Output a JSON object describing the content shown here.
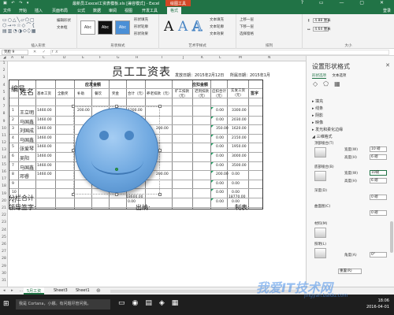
{
  "titlebar": {
    "title": "最新员工excel工资表模板.xls [兼容模式] - Excel",
    "context_tools": "绘图工具",
    "window_buttons": "? ▭ — ▢ ✕"
  },
  "tabs": [
    "文件",
    "开始",
    "插入",
    "页面布局",
    "公式",
    "数据",
    "审阅",
    "视图",
    "开发工具",
    "格式"
  ],
  "active_tab": "格式",
  "sign_in": "登录",
  "ribbon": {
    "insert_shapes": {
      "name": "插入形状",
      "edit_shape": "编辑形状",
      "text_box": "文本框"
    },
    "shape_styles": {
      "name": "形状样式",
      "swatches": [
        "Abc",
        "Abc",
        "Abc"
      ],
      "fill": "形状填充",
      "outline": "形状轮廓",
      "effects": "形状效果"
    },
    "wordart": {
      "name": "艺术字样式",
      "letters": [
        "A",
        "A",
        "A"
      ],
      "text_fill": "文本填充",
      "text_outline": "文本轮廓",
      "text_effects": "文本效果"
    },
    "arrange": {
      "name": "排列",
      "items": [
        "上移一层",
        "下移一层",
        "选择窗格"
      ]
    },
    "size": {
      "name": "大小",
      "height": "4.88 厘米",
      "width": "4.64 厘米"
    }
  },
  "formula_bar": {
    "name_box": "笑脸 9",
    "fx": "✕ ✓ fx",
    "value": ""
  },
  "columns": [
    "A",
    "B",
    "C",
    "D",
    "E",
    "F",
    "G",
    "H",
    "I",
    "J",
    "K",
    "L",
    "M",
    "N"
  ],
  "rows": [
    "1",
    "2",
    "3",
    "4",
    "5",
    "6",
    "7",
    "8",
    "9",
    "10",
    "11",
    "12",
    "13",
    "14",
    "15",
    "16",
    "17",
    "18",
    "19",
    "20",
    "21",
    "22",
    "23",
    "24",
    "25",
    "26",
    "27",
    "28",
    "29",
    "30",
    "31"
  ],
  "sheet": {
    "title": "员工工资表",
    "issue_date": "发放日期：2015年2月12日",
    "statement_date": "所属日期：2015年1月",
    "headers": {
      "seq": "编号",
      "name": "姓名",
      "payable": "应发金额",
      "deduct": "应扣金额",
      "net_pay": "实发工资（元）",
      "sign": "签字",
      "base": "基本工资",
      "position": "全勤奖",
      "allowance": "补助",
      "subsidy": "餐饮",
      "bonus": "奖金",
      "total": "合计（元）",
      "social": "养老扣款（元）",
      "absence": "旷工扣款（元）",
      "late": "迟到扣款（元）",
      "deduct_total": "应扣合计（元）"
    },
    "data_rows": [
      {
        "seq": "1",
        "name": "王立明",
        "base": "1460.00",
        "allow": "200.00",
        "total": "1200.00",
        "social": "",
        "deduct": "0.00",
        "net": "3300.00"
      },
      {
        "seq": "2",
        "name": "马国鑫",
        "base": "1460.00",
        "allow": "",
        "total": "",
        "social": "",
        "deduct": "0.00",
        "net": "2030.00"
      },
      {
        "seq": "3",
        "name": "刘国成",
        "base": "1460.00",
        "allow": "",
        "total": "",
        "social": "200.00",
        "deduct": "350.00",
        "net": "1620.00"
      },
      {
        "seq": "4",
        "name": "马国鑫",
        "base": "1460.00",
        "allow": "",
        "total": "",
        "social": "",
        "deduct": "0.00",
        "net": "2150.00"
      },
      {
        "seq": "5",
        "name": "张爱琴",
        "base": "1460.00",
        "allow": "",
        "total": "",
        "social": "",
        "deduct": "0.00",
        "net": "1950.00"
      },
      {
        "seq": "6",
        "name": "吴阳",
        "base": "1460.00",
        "allow": "",
        "total": "",
        "social": "",
        "deduct": "0.00",
        "net": "3000.00"
      },
      {
        "seq": "7",
        "name": "马国鑫",
        "base": "1460.00",
        "allow": "",
        "total": "",
        "social": "",
        "deduct": "0.00",
        "net": "3500.00"
      },
      {
        "seq": "8",
        "name": "邓睿",
        "base": "1460.00",
        "allow": "",
        "total": "",
        "social": "200.00",
        "deduct": "200.00",
        "net": "0.00"
      },
      {
        "seq": "9",
        "name": "",
        "base": "",
        "allow": "",
        "total": "",
        "social": "",
        "deduct": "0.00",
        "net": "0.00"
      },
      {
        "seq": "10",
        "name": "",
        "base": "",
        "allow": "",
        "total": "",
        "social": "",
        "deduct": "0.00",
        "net": "0.00"
      },
      {
        "seq": "11",
        "name": "",
        "base": "",
        "allow": "",
        "total": "0.00",
        "social": "",
        "deduct": "0.00",
        "net": "0.00"
      }
    ],
    "subtotal_label": "分栏合计",
    "subtotal_total": "18600.00",
    "subtotal_net": "18770.00",
    "footer": {
      "leader": "领导签字:",
      "cashier": "出纳:",
      "maker": "制表:"
    }
  },
  "format_pane": {
    "title": "设置形状格式",
    "close": "✕",
    "tabs": [
      "形状选项",
      "文本选项"
    ],
    "sections": [
      "填充",
      "线条",
      "阴影",
      "映像",
      "发光和柔化边缘",
      "三维格式"
    ],
    "top_bevel": "顶部棱台(T)",
    "bottom_bevel": "底部棱台(B)",
    "width_label": "宽度(W)",
    "height_label": "高度(H)",
    "top_width": "10 磅",
    "top_height": "6 磅",
    "bottom_width": "10磅",
    "bottom_height": "6 磅",
    "depth": "深度(D)",
    "depth_size": "0 磅",
    "contour": "曲面图(C)",
    "contour_size": "0 磅",
    "material": "材料(M)",
    "lighting": "照明(L)",
    "angle_label": "角度(A)",
    "angle": "0°",
    "reset": "重置(R)",
    "size_label": "大小(S)"
  },
  "sheet_tabs": [
    "5月工资",
    "Sheet3",
    "Sheet1"
  ],
  "active_sheet": "5月工资",
  "taskbar": {
    "search": "我是 Cortana，小娜。有问题尽管问我。",
    "time": "18:06",
    "date": "2016-04-01"
  },
  "watermark": "我爱IT技术网",
  "watermark_url": "jingyan.baidu.com"
}
